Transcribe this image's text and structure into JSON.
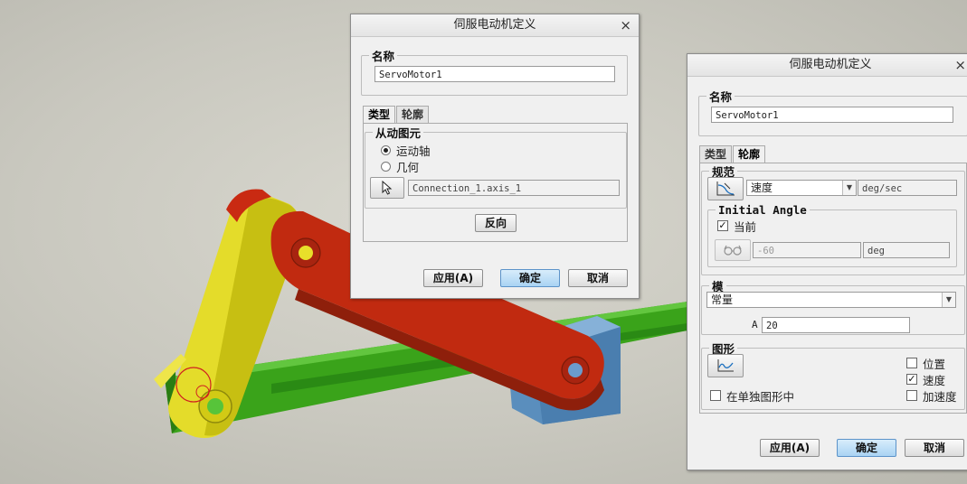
{
  "dialog_left": {
    "title": "伺服电动机定义",
    "close_glyph": "×",
    "name_group": {
      "legend": "名称",
      "value": "ServoMotor1"
    },
    "tabs": [
      {
        "label": "类型",
        "active": true
      },
      {
        "label": "轮廓",
        "active": false
      }
    ],
    "driven_group": {
      "legend": "从动图元",
      "options": [
        {
          "label": "运动轴",
          "selected": true
        },
        {
          "label": "几何",
          "selected": false
        }
      ],
      "reference": "Connection_1.axis_1"
    },
    "reverse_button": "反向",
    "buttons": {
      "apply": "应用(A)",
      "ok": "确定",
      "cancel": "取消"
    }
  },
  "dialog_right": {
    "title": "伺服电动机定义",
    "close_glyph": "×",
    "name_group": {
      "legend": "名称",
      "value": "ServoMotor1"
    },
    "tabs": [
      {
        "label": "类型",
        "active": false
      },
      {
        "label": "轮廓",
        "active": true
      }
    ],
    "spec_group": {
      "legend": "规范",
      "selected": "速度",
      "unit": "deg/sec",
      "initial_angle": {
        "legend": "Initial Angle",
        "current_label": "当前",
        "current_checked": true,
        "value": "-60",
        "unit": "deg"
      }
    },
    "model_group": {
      "legend": "模",
      "selected": "常量",
      "a_label": "A",
      "a_value": "20"
    },
    "graph_group": {
      "legend": "图形",
      "separate_label": "在单独图形中",
      "separate_checked": false,
      "options": [
        {
          "label": "位置",
          "checked": false
        },
        {
          "label": "速度",
          "checked": true
        },
        {
          "label": "加速度",
          "checked": false
        }
      ]
    },
    "buttons": {
      "apply": "应用(A)",
      "ok": "确定",
      "cancel": "取消"
    }
  },
  "icons": {
    "select_arrow": "cursor-arrow-icon",
    "spec_graph": "velocity-graph-icon",
    "glasses": "glasses-icon",
    "graph": "graph-plot-icon"
  },
  "colors": {
    "crank": "#d4cf1f",
    "link": "#c42b12",
    "ground": "#3da51c",
    "slider": "#5b8fbf",
    "primary_button": "#a9d3f3"
  }
}
